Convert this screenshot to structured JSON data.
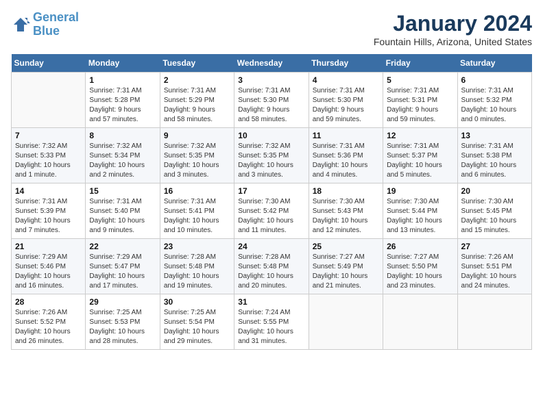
{
  "header": {
    "logo_line1": "General",
    "logo_line2": "Blue",
    "month_title": "January 2024",
    "location": "Fountain Hills, Arizona, United States"
  },
  "days_of_week": [
    "Sunday",
    "Monday",
    "Tuesday",
    "Wednesday",
    "Thursday",
    "Friday",
    "Saturday"
  ],
  "weeks": [
    [
      {
        "num": "",
        "info": ""
      },
      {
        "num": "1",
        "info": "Sunrise: 7:31 AM\nSunset: 5:28 PM\nDaylight: 9 hours\nand 57 minutes."
      },
      {
        "num": "2",
        "info": "Sunrise: 7:31 AM\nSunset: 5:29 PM\nDaylight: 9 hours\nand 58 minutes."
      },
      {
        "num": "3",
        "info": "Sunrise: 7:31 AM\nSunset: 5:30 PM\nDaylight: 9 hours\nand 58 minutes."
      },
      {
        "num": "4",
        "info": "Sunrise: 7:31 AM\nSunset: 5:30 PM\nDaylight: 9 hours\nand 59 minutes."
      },
      {
        "num": "5",
        "info": "Sunrise: 7:31 AM\nSunset: 5:31 PM\nDaylight: 9 hours\nand 59 minutes."
      },
      {
        "num": "6",
        "info": "Sunrise: 7:31 AM\nSunset: 5:32 PM\nDaylight: 10 hours\nand 0 minutes."
      }
    ],
    [
      {
        "num": "7",
        "info": "Sunrise: 7:32 AM\nSunset: 5:33 PM\nDaylight: 10 hours\nand 1 minute."
      },
      {
        "num": "8",
        "info": "Sunrise: 7:32 AM\nSunset: 5:34 PM\nDaylight: 10 hours\nand 2 minutes."
      },
      {
        "num": "9",
        "info": "Sunrise: 7:32 AM\nSunset: 5:35 PM\nDaylight: 10 hours\nand 3 minutes."
      },
      {
        "num": "10",
        "info": "Sunrise: 7:32 AM\nSunset: 5:35 PM\nDaylight: 10 hours\nand 3 minutes."
      },
      {
        "num": "11",
        "info": "Sunrise: 7:31 AM\nSunset: 5:36 PM\nDaylight: 10 hours\nand 4 minutes."
      },
      {
        "num": "12",
        "info": "Sunrise: 7:31 AM\nSunset: 5:37 PM\nDaylight: 10 hours\nand 5 minutes."
      },
      {
        "num": "13",
        "info": "Sunrise: 7:31 AM\nSunset: 5:38 PM\nDaylight: 10 hours\nand 6 minutes."
      }
    ],
    [
      {
        "num": "14",
        "info": "Sunrise: 7:31 AM\nSunset: 5:39 PM\nDaylight: 10 hours\nand 7 minutes."
      },
      {
        "num": "15",
        "info": "Sunrise: 7:31 AM\nSunset: 5:40 PM\nDaylight: 10 hours\nand 9 minutes."
      },
      {
        "num": "16",
        "info": "Sunrise: 7:31 AM\nSunset: 5:41 PM\nDaylight: 10 hours\nand 10 minutes."
      },
      {
        "num": "17",
        "info": "Sunrise: 7:30 AM\nSunset: 5:42 PM\nDaylight: 10 hours\nand 11 minutes."
      },
      {
        "num": "18",
        "info": "Sunrise: 7:30 AM\nSunset: 5:43 PM\nDaylight: 10 hours\nand 12 minutes."
      },
      {
        "num": "19",
        "info": "Sunrise: 7:30 AM\nSunset: 5:44 PM\nDaylight: 10 hours\nand 13 minutes."
      },
      {
        "num": "20",
        "info": "Sunrise: 7:30 AM\nSunset: 5:45 PM\nDaylight: 10 hours\nand 15 minutes."
      }
    ],
    [
      {
        "num": "21",
        "info": "Sunrise: 7:29 AM\nSunset: 5:46 PM\nDaylight: 10 hours\nand 16 minutes."
      },
      {
        "num": "22",
        "info": "Sunrise: 7:29 AM\nSunset: 5:47 PM\nDaylight: 10 hours\nand 17 minutes."
      },
      {
        "num": "23",
        "info": "Sunrise: 7:28 AM\nSunset: 5:48 PM\nDaylight: 10 hours\nand 19 minutes."
      },
      {
        "num": "24",
        "info": "Sunrise: 7:28 AM\nSunset: 5:48 PM\nDaylight: 10 hours\nand 20 minutes."
      },
      {
        "num": "25",
        "info": "Sunrise: 7:27 AM\nSunset: 5:49 PM\nDaylight: 10 hours\nand 21 minutes."
      },
      {
        "num": "26",
        "info": "Sunrise: 7:27 AM\nSunset: 5:50 PM\nDaylight: 10 hours\nand 23 minutes."
      },
      {
        "num": "27",
        "info": "Sunrise: 7:26 AM\nSunset: 5:51 PM\nDaylight: 10 hours\nand 24 minutes."
      }
    ],
    [
      {
        "num": "28",
        "info": "Sunrise: 7:26 AM\nSunset: 5:52 PM\nDaylight: 10 hours\nand 26 minutes."
      },
      {
        "num": "29",
        "info": "Sunrise: 7:25 AM\nSunset: 5:53 PM\nDaylight: 10 hours\nand 28 minutes."
      },
      {
        "num": "30",
        "info": "Sunrise: 7:25 AM\nSunset: 5:54 PM\nDaylight: 10 hours\nand 29 minutes."
      },
      {
        "num": "31",
        "info": "Sunrise: 7:24 AM\nSunset: 5:55 PM\nDaylight: 10 hours\nand 31 minutes."
      },
      {
        "num": "",
        "info": ""
      },
      {
        "num": "",
        "info": ""
      },
      {
        "num": "",
        "info": ""
      }
    ]
  ]
}
